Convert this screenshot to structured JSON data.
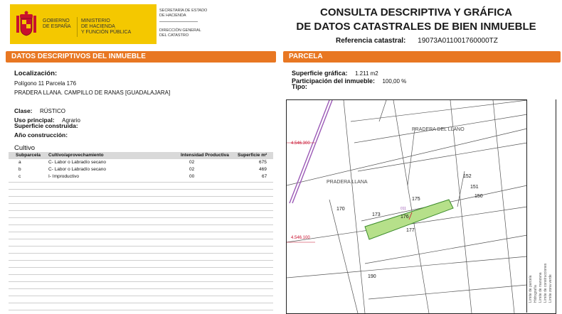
{
  "header": {
    "gov_line1": "GOBIERNO",
    "gov_line2": "DE ESPAÑA",
    "ministry_line1": "MINISTERIO",
    "ministry_line2": "DE HACIENDA",
    "ministry_line3": "Y FUNCIÓN PÚBLICA",
    "secretaria_line1": "SECRETARÍA DE ESTADO",
    "secretaria_line2": "DE HACIENDA",
    "direccion_line1": "DIRECCIÓN GENERAL",
    "direccion_line2": "DEL CATASTRO",
    "title_line1": "CONSULTA DESCRIPTIVA Y GRÁFICA",
    "title_line2": "DE DATOS CATASTRALES DE BIEN INMUEBLE",
    "ref_label": "Referencia catastral:",
    "ref_value": "19073A011001760000TZ"
  },
  "left": {
    "section_prefix": "DATOS DESCRIPTIVOS DEL ",
    "section_suffix": "INMUEBLE",
    "localizacion_label": "Localización:",
    "loc_line1": "Polígono 11 Parcela 176",
    "loc_line2": "PRADERA LLANA. CAMPILLO DE RANAS [GUADALAJARA]",
    "clase_label": "Clase:",
    "clase_value": "RÚSTICO",
    "uso_label": "Uso principal:",
    "uso_value": "Agrario",
    "sup_label": "Superficie construida:",
    "anio_label": "Año construcción:",
    "cultivo_label": "Cultivo",
    "table_headers": {
      "subparcela": "Subparcela",
      "cultivo": "Cultivo/aprovechamiento",
      "intensidad": "Intensidad Productiva",
      "superficie": "Superficie m²"
    },
    "rows": [
      {
        "sub": "a",
        "cultivo": "C- Labor o Labradío secano",
        "int": "02",
        "sup": "675"
      },
      {
        "sub": "b",
        "cultivo": "C- Labor o Labradío secano",
        "int": "02",
        "sup": "469"
      },
      {
        "sub": "c",
        "cultivo": "I- Improductivo",
        "int": "00",
        "sup": "67"
      }
    ]
  },
  "right": {
    "section_label": "PARCELA",
    "sup_grafica_label": "Superficie gráfica:",
    "sup_grafica_value": "1.211 m2",
    "participacion_label": "Participación del inmueble:",
    "participacion_value": "100,00 %",
    "tipo_label": "Tipo:",
    "map_labels": {
      "pradera_llano": "PRADERA DEL LLANO",
      "pradera_llana": "PRADERA LLANA",
      "coord1": "4.546.300",
      "coord2": "4.546.100",
      "p152": "152",
      "p151": "151",
      "p150": "150",
      "p175": "175",
      "p170": "170",
      "p173": "173",
      "p176": "176",
      "p177": "177",
      "p190": "190",
      "sub_label": "011"
    },
    "legend": {
      "l1": "Límite de parcela",
      "l2": "Hidrografía",
      "l3": "Límite de manzana",
      "l4": "Límite de construcciones",
      "l5": "Límite zona verde"
    }
  },
  "colors": {
    "accent": "#e87722",
    "gov_yellow": "#f4c800",
    "parcel_fill": "#b6e08a",
    "map_red": "#c8102e",
    "map_purple": "#9b59b6"
  }
}
